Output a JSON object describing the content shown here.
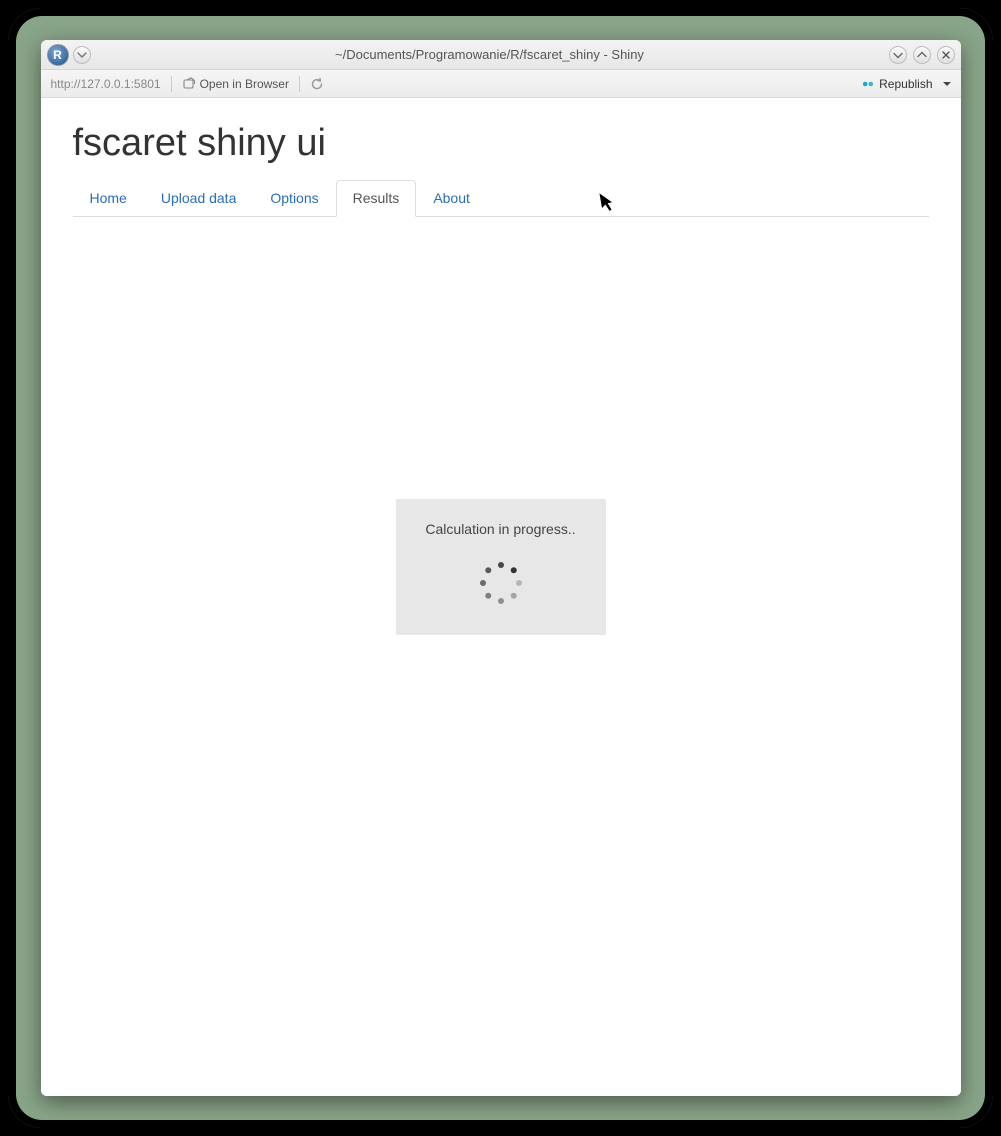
{
  "window": {
    "title": "~/Documents/Programowanie/R/fscaret_shiny - Shiny",
    "app_logo_letter": "R"
  },
  "toolbar": {
    "url": "http://127.0.0.1:5801",
    "open_in_browser": "Open in Browser",
    "republish": "Republish"
  },
  "page": {
    "title": "fscaret shiny ui"
  },
  "tabs": [
    {
      "label": "Home",
      "active": false
    },
    {
      "label": "Upload data",
      "active": false
    },
    {
      "label": "Options",
      "active": false
    },
    {
      "label": "Results",
      "active": true
    },
    {
      "label": "About",
      "active": false
    }
  ],
  "progress": {
    "text": "Calculation in progress.."
  }
}
